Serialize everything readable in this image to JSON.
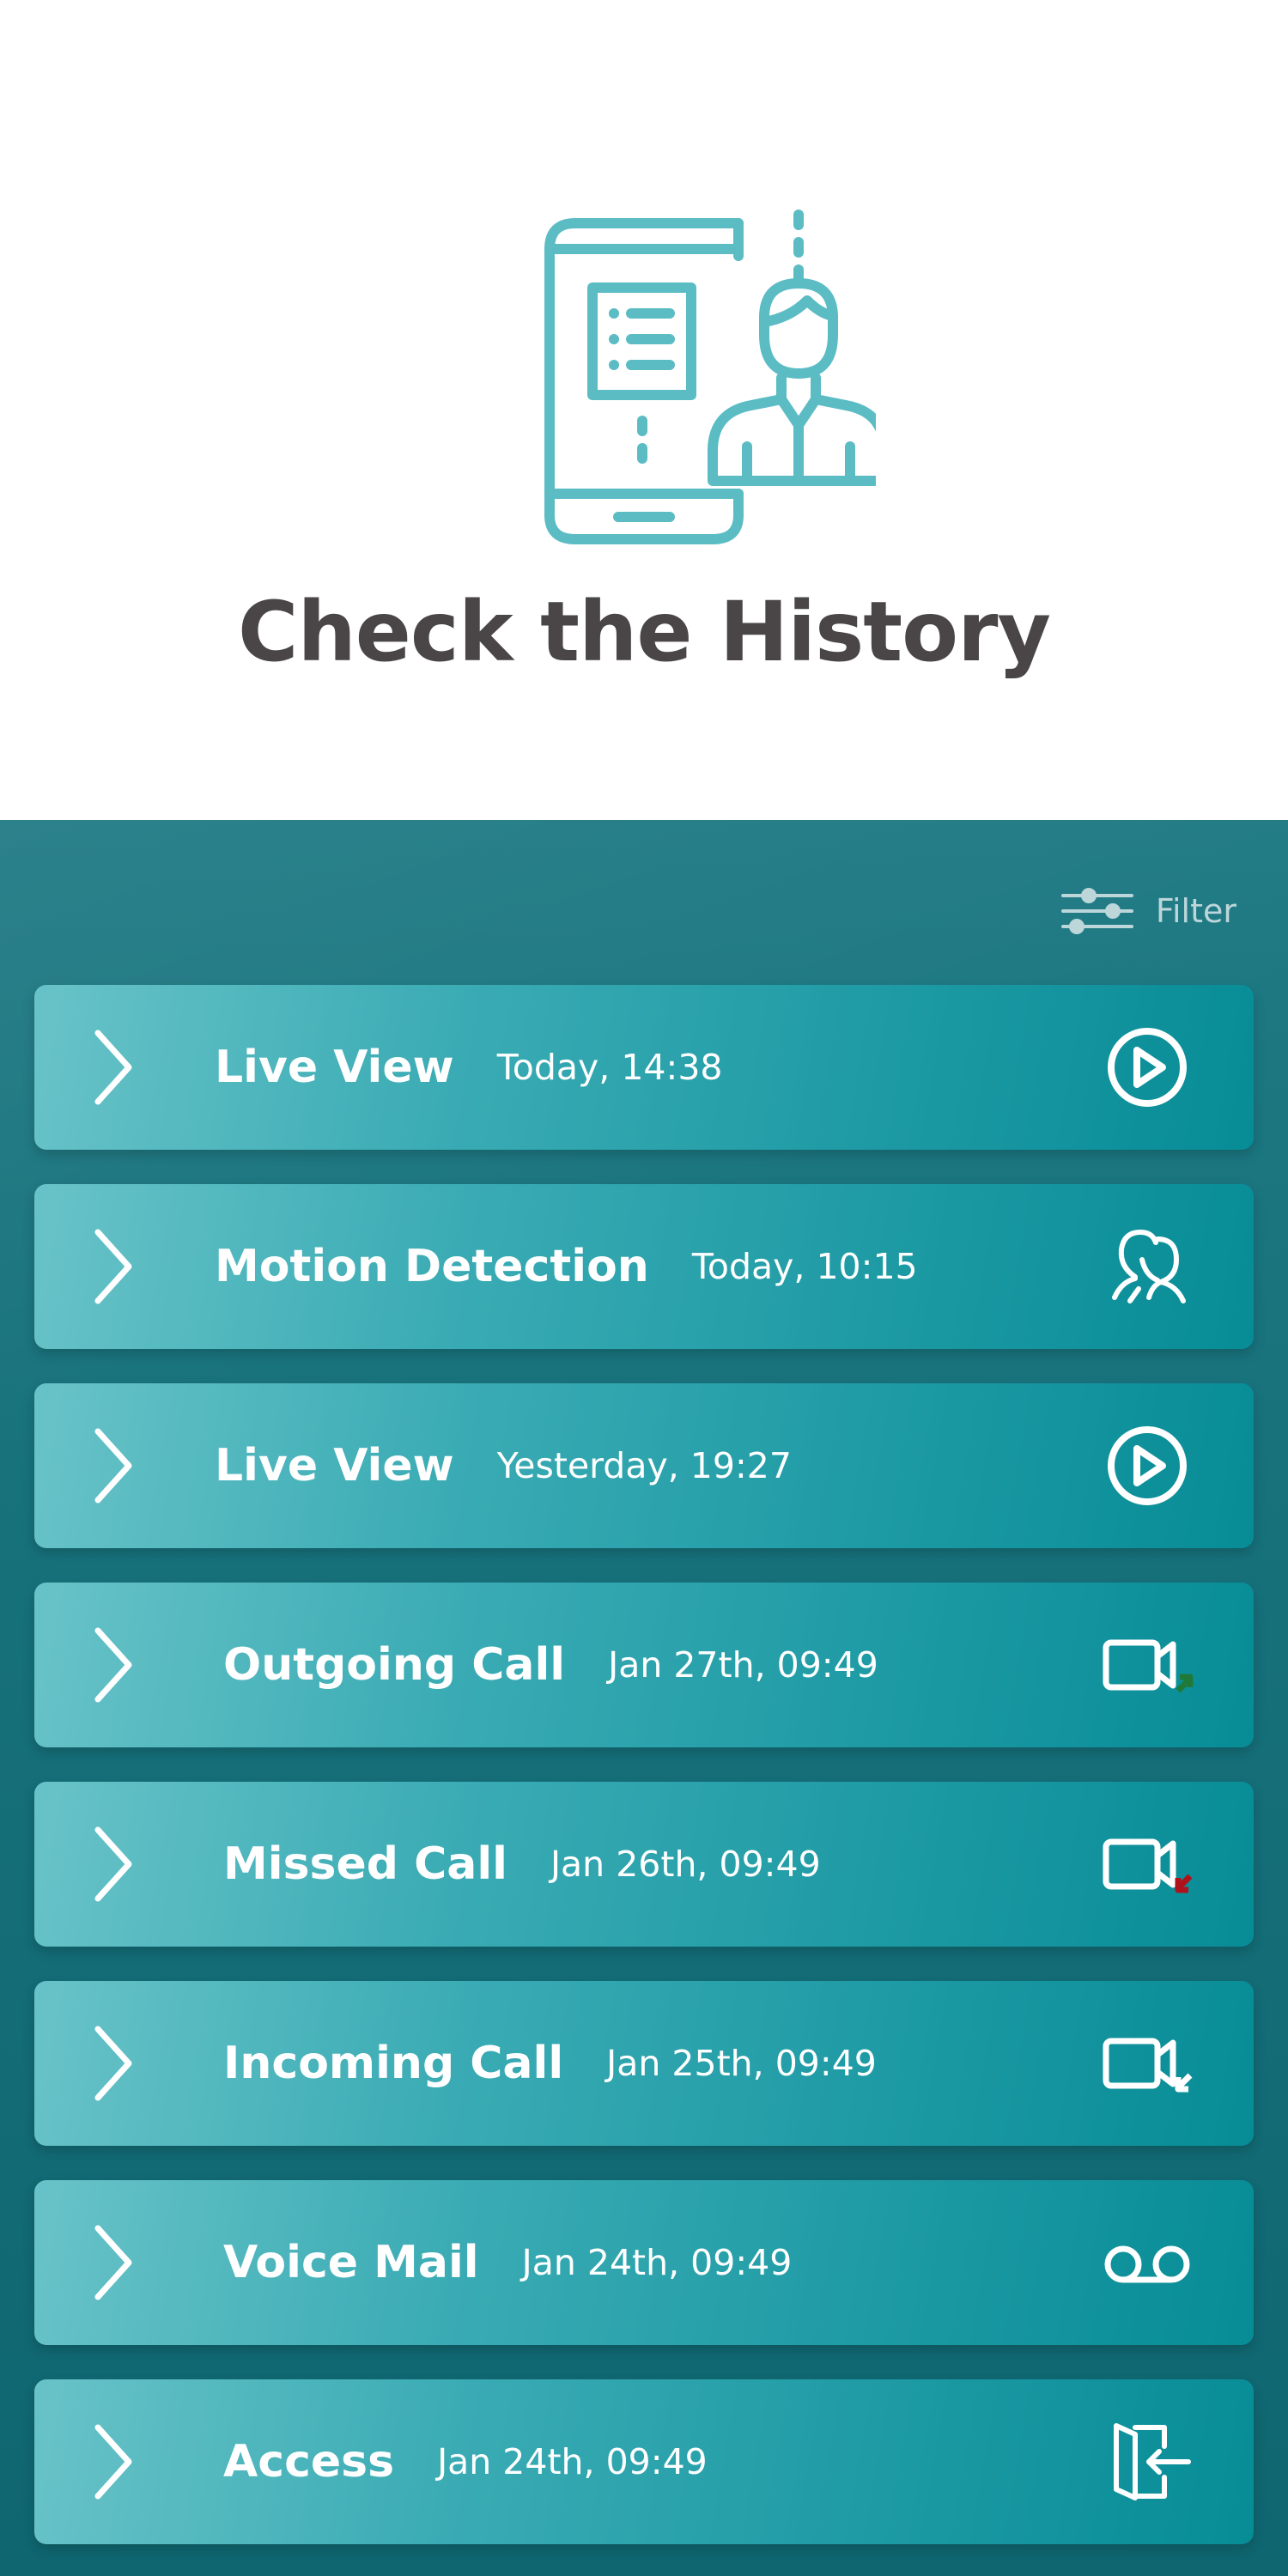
{
  "hero": {
    "title": "Check the History",
    "illustration_icon": "phone-with-user-profile-icon",
    "accent_color": "#5bbcc4"
  },
  "filter": {
    "label": "Filter",
    "icon": "sliders-icon"
  },
  "history": {
    "items": [
      {
        "title": "Live View",
        "time": "Today, 14:38",
        "icon": "play-circle-icon"
      },
      {
        "title": "Motion Detection",
        "time": "Today, 10:15",
        "icon": "motion-person-icon"
      },
      {
        "title": "Live View",
        "time": "Yesterday, 19:27",
        "icon": "play-circle-icon"
      },
      {
        "title": "Outgoing Call",
        "time": "Jan 27th, 09:49",
        "icon": "video-call-outgoing-icon",
        "status_color": "#1f7a3a"
      },
      {
        "title": "Missed Call",
        "time": "Jan 26th, 09:49",
        "icon": "video-call-missed-icon",
        "status_color": "#b0121b"
      },
      {
        "title": "Incoming Call",
        "time": "Jan 25th, 09:49",
        "icon": "video-call-incoming-icon"
      },
      {
        "title": "Voice Mail",
        "time": "Jan 24th, 09:49",
        "icon": "voicemail-icon"
      },
      {
        "title": "Access",
        "time": "Jan 24th, 09:49",
        "icon": "door-enter-icon"
      }
    ]
  },
  "colors": {
    "panel_bg": "#16707a",
    "row_gradient_start": "#68c3c8",
    "row_gradient_end": "#078c96",
    "title_text": "#4a4647"
  }
}
